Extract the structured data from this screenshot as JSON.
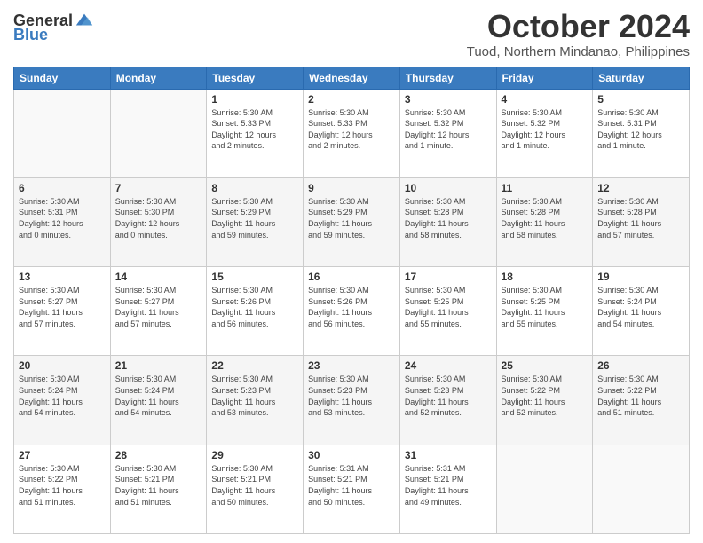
{
  "logo": {
    "general": "General",
    "blue": "Blue"
  },
  "header": {
    "month": "October 2024",
    "location": "Tuod, Northern Mindanao, Philippines"
  },
  "weekdays": [
    "Sunday",
    "Monday",
    "Tuesday",
    "Wednesday",
    "Thursday",
    "Friday",
    "Saturday"
  ],
  "weeks": [
    [
      {
        "day": "",
        "text": ""
      },
      {
        "day": "",
        "text": ""
      },
      {
        "day": "1",
        "text": "Sunrise: 5:30 AM\nSunset: 5:33 PM\nDaylight: 12 hours\nand 2 minutes."
      },
      {
        "day": "2",
        "text": "Sunrise: 5:30 AM\nSunset: 5:33 PM\nDaylight: 12 hours\nand 2 minutes."
      },
      {
        "day": "3",
        "text": "Sunrise: 5:30 AM\nSunset: 5:32 PM\nDaylight: 12 hours\nand 1 minute."
      },
      {
        "day": "4",
        "text": "Sunrise: 5:30 AM\nSunset: 5:32 PM\nDaylight: 12 hours\nand 1 minute."
      },
      {
        "day": "5",
        "text": "Sunrise: 5:30 AM\nSunset: 5:31 PM\nDaylight: 12 hours\nand 1 minute."
      }
    ],
    [
      {
        "day": "6",
        "text": "Sunrise: 5:30 AM\nSunset: 5:31 PM\nDaylight: 12 hours\nand 0 minutes."
      },
      {
        "day": "7",
        "text": "Sunrise: 5:30 AM\nSunset: 5:30 PM\nDaylight: 12 hours\nand 0 minutes."
      },
      {
        "day": "8",
        "text": "Sunrise: 5:30 AM\nSunset: 5:29 PM\nDaylight: 11 hours\nand 59 minutes."
      },
      {
        "day": "9",
        "text": "Sunrise: 5:30 AM\nSunset: 5:29 PM\nDaylight: 11 hours\nand 59 minutes."
      },
      {
        "day": "10",
        "text": "Sunrise: 5:30 AM\nSunset: 5:28 PM\nDaylight: 11 hours\nand 58 minutes."
      },
      {
        "day": "11",
        "text": "Sunrise: 5:30 AM\nSunset: 5:28 PM\nDaylight: 11 hours\nand 58 minutes."
      },
      {
        "day": "12",
        "text": "Sunrise: 5:30 AM\nSunset: 5:28 PM\nDaylight: 11 hours\nand 57 minutes."
      }
    ],
    [
      {
        "day": "13",
        "text": "Sunrise: 5:30 AM\nSunset: 5:27 PM\nDaylight: 11 hours\nand 57 minutes."
      },
      {
        "day": "14",
        "text": "Sunrise: 5:30 AM\nSunset: 5:27 PM\nDaylight: 11 hours\nand 57 minutes."
      },
      {
        "day": "15",
        "text": "Sunrise: 5:30 AM\nSunset: 5:26 PM\nDaylight: 11 hours\nand 56 minutes."
      },
      {
        "day": "16",
        "text": "Sunrise: 5:30 AM\nSunset: 5:26 PM\nDaylight: 11 hours\nand 56 minutes."
      },
      {
        "day": "17",
        "text": "Sunrise: 5:30 AM\nSunset: 5:25 PM\nDaylight: 11 hours\nand 55 minutes."
      },
      {
        "day": "18",
        "text": "Sunrise: 5:30 AM\nSunset: 5:25 PM\nDaylight: 11 hours\nand 55 minutes."
      },
      {
        "day": "19",
        "text": "Sunrise: 5:30 AM\nSunset: 5:24 PM\nDaylight: 11 hours\nand 54 minutes."
      }
    ],
    [
      {
        "day": "20",
        "text": "Sunrise: 5:30 AM\nSunset: 5:24 PM\nDaylight: 11 hours\nand 54 minutes."
      },
      {
        "day": "21",
        "text": "Sunrise: 5:30 AM\nSunset: 5:24 PM\nDaylight: 11 hours\nand 54 minutes."
      },
      {
        "day": "22",
        "text": "Sunrise: 5:30 AM\nSunset: 5:23 PM\nDaylight: 11 hours\nand 53 minutes."
      },
      {
        "day": "23",
        "text": "Sunrise: 5:30 AM\nSunset: 5:23 PM\nDaylight: 11 hours\nand 53 minutes."
      },
      {
        "day": "24",
        "text": "Sunrise: 5:30 AM\nSunset: 5:23 PM\nDaylight: 11 hours\nand 52 minutes."
      },
      {
        "day": "25",
        "text": "Sunrise: 5:30 AM\nSunset: 5:22 PM\nDaylight: 11 hours\nand 52 minutes."
      },
      {
        "day": "26",
        "text": "Sunrise: 5:30 AM\nSunset: 5:22 PM\nDaylight: 11 hours\nand 51 minutes."
      }
    ],
    [
      {
        "day": "27",
        "text": "Sunrise: 5:30 AM\nSunset: 5:22 PM\nDaylight: 11 hours\nand 51 minutes."
      },
      {
        "day": "28",
        "text": "Sunrise: 5:30 AM\nSunset: 5:21 PM\nDaylight: 11 hours\nand 51 minutes."
      },
      {
        "day": "29",
        "text": "Sunrise: 5:30 AM\nSunset: 5:21 PM\nDaylight: 11 hours\nand 50 minutes."
      },
      {
        "day": "30",
        "text": "Sunrise: 5:31 AM\nSunset: 5:21 PM\nDaylight: 11 hours\nand 50 minutes."
      },
      {
        "day": "31",
        "text": "Sunrise: 5:31 AM\nSunset: 5:21 PM\nDaylight: 11 hours\nand 49 minutes."
      },
      {
        "day": "",
        "text": ""
      },
      {
        "day": "",
        "text": ""
      }
    ]
  ]
}
